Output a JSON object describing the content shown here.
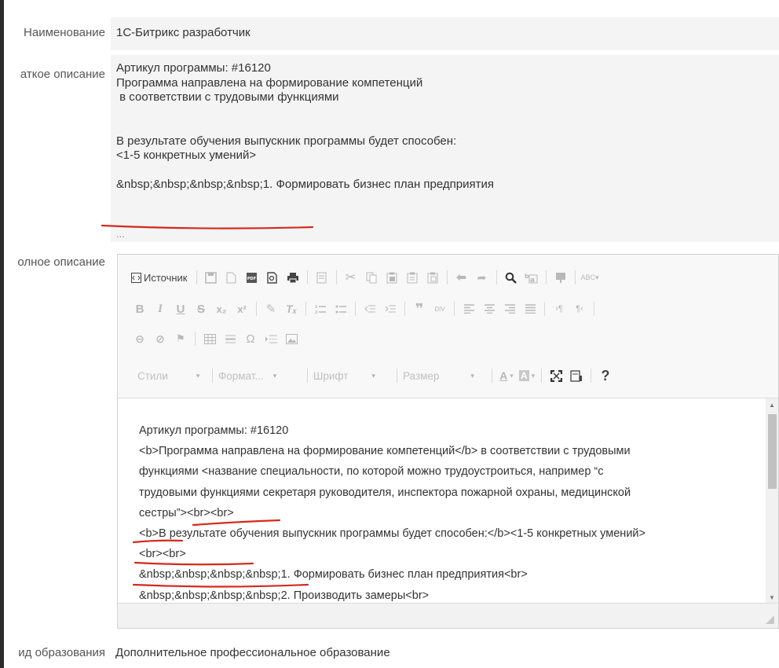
{
  "fields": {
    "name": {
      "label": "Наименование",
      "value": "1С-Битрикс разработчик"
    },
    "short_description": {
      "label": "аткое описание",
      "lines": [
        "Артикул программы: #16120",
        "Программа направлена на формирование компетенций",
        " в соответствии с трудовыми функциями",
        "",
        "",
        "В результате обучения выпускник программы будет способен:",
        "<1-5 конкретных умений>",
        "",
        "&nbsp;&nbsp;&nbsp;&nbsp;1. Формировать бизнес план предприятия"
      ],
      "ellipsis": "..."
    },
    "full_description": {
      "label": "олное описание"
    },
    "education_type": {
      "label": "ид образования",
      "value": "Дополнительное профессиональное образование"
    }
  },
  "editor": {
    "source_label": "Источник",
    "combos": {
      "styles": "Стили",
      "format": "Формат...",
      "font": "Шрифт",
      "size": "Размер"
    },
    "help": "?",
    "content_lines": [
      "Артикул программы: #16120",
      "<b>Программа направлена на формирование компетенций</b> в соответствии с трудовыми",
      "функциями <название специальности, по которой можно трудоустроиться, например “с",
      "трудовыми функциями секретаря руководителя, инспектора пожарной охраны, медицинской",
      "сестры”><br><br>",
      "<b>В результате обучения выпускник программы будет способен:</b><1-5 конкретных умений>",
      "<br><br>",
      "&nbsp;&nbsp;&nbsp;&nbsp;1. Формировать бизнес план предприятия<br>",
      "&nbsp;&nbsp;&nbsp;&nbsp;2. Производить замеры<br>"
    ]
  },
  "colors": {
    "annotation": "#d42a1e",
    "field_background": "#f4f4f4",
    "toolbar_icon_disabled": "#b8b8b8",
    "toolbar_icon_active": "#444444"
  },
  "icons": {
    "row1": [
      "source-icon",
      "save-icon",
      "new-page-icon",
      "export-pdf-icon",
      "preview-icon",
      "print-icon",
      "templates-icon",
      "cut-icon",
      "copy-icon",
      "paste-icon",
      "paste-text-icon",
      "paste-word-icon",
      "undo-icon",
      "redo-icon",
      "find-icon",
      "replace-icon",
      "select-all-icon",
      "spellcheck-icon"
    ],
    "row2": [
      "bold-icon",
      "italic-icon",
      "underline-icon",
      "strike-icon",
      "subscript-icon",
      "superscript-icon",
      "copy-format-icon",
      "remove-format-icon",
      "numbered-list-icon",
      "bulleted-list-icon",
      "outdent-icon",
      "indent-icon",
      "blockquote-icon",
      "div-icon",
      "align-left-icon",
      "align-center-icon",
      "align-right-icon",
      "justify-icon",
      "ltr-icon",
      "rtl-icon"
    ],
    "row3": [
      "link-icon",
      "unlink-icon",
      "anchor-icon",
      "table-icon",
      "horizontal-line-icon",
      "special-char-icon",
      "page-break-icon",
      "image-icon"
    ],
    "row4": [
      "text-color-icon",
      "bg-color-icon",
      "maximize-icon",
      "show-blocks-icon",
      "help-icon"
    ]
  }
}
